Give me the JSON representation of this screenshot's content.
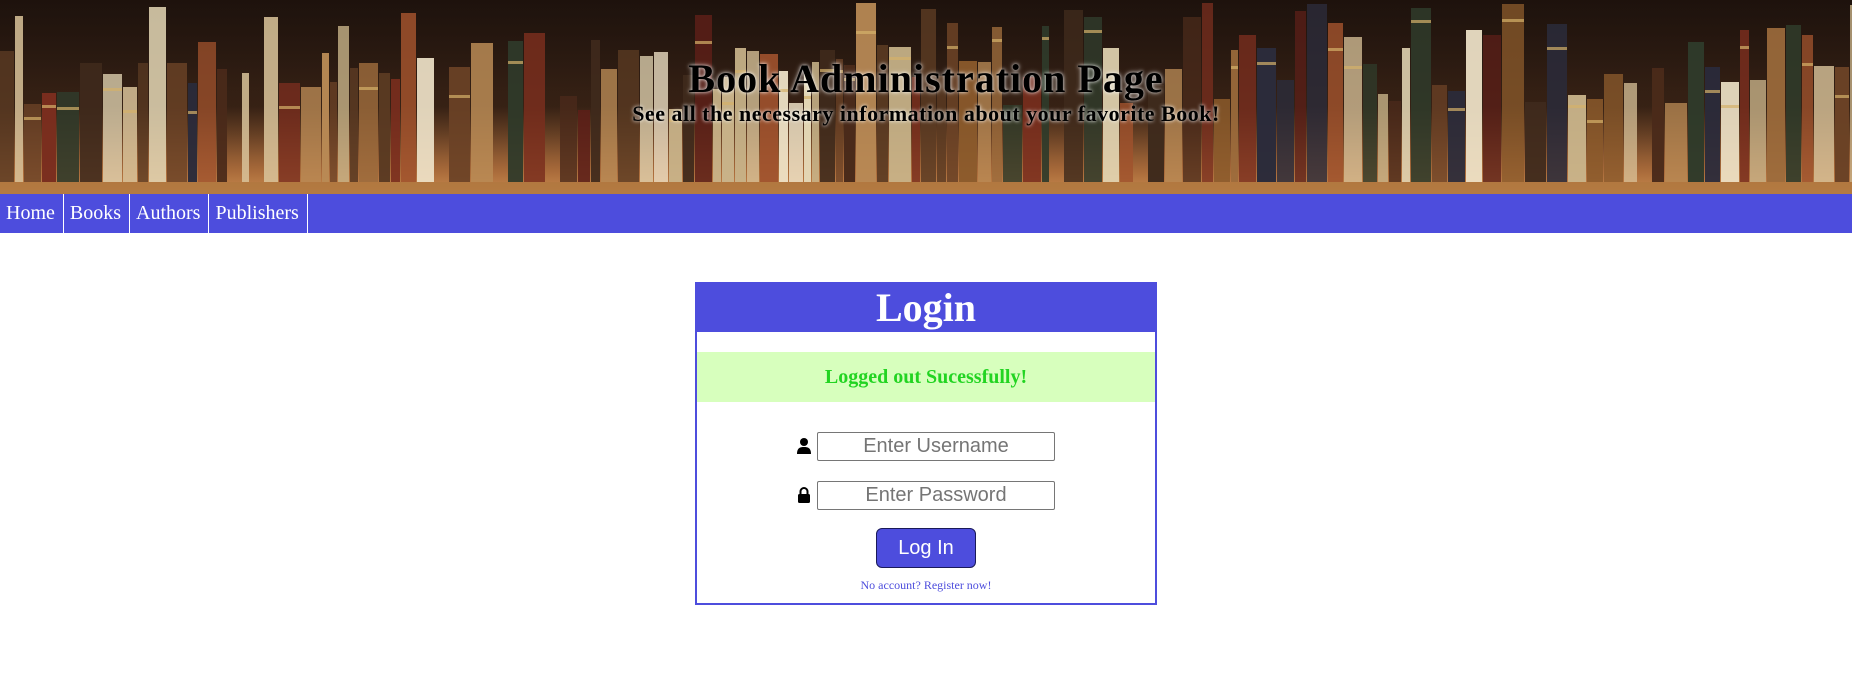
{
  "banner": {
    "title": "Book Administration Page",
    "subtitle": "See all the necessary information about your favorite Book!"
  },
  "nav": {
    "items": [
      {
        "label": "Home"
      },
      {
        "label": "Books"
      },
      {
        "label": "Authors"
      },
      {
        "label": "Publishers"
      }
    ]
  },
  "login": {
    "heading": "Login",
    "alert_message": "Logged out Sucessfully!",
    "username": {
      "placeholder": "Enter Username",
      "value": "",
      "icon": "user-icon"
    },
    "password": {
      "placeholder": "Enter Password",
      "value": "",
      "icon": "lock-icon"
    },
    "submit_label": "Log In",
    "register_text": "No account? Register now!"
  },
  "colors": {
    "accent": "#4d4ddd",
    "alert_background": "#d7ffbd",
    "alert_text": "#22d422"
  }
}
